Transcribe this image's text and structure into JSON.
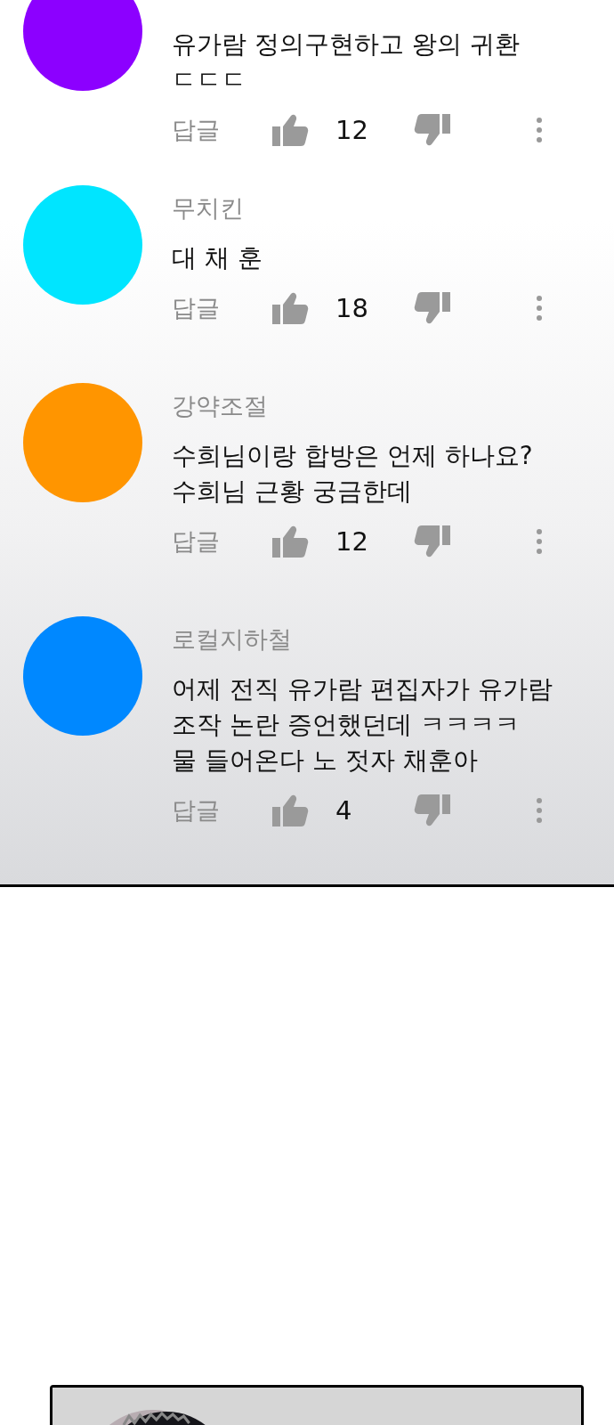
{
  "comments": [
    {
      "color": "#8c00ff",
      "body": [
        "유가람 정의구현하고 왕의 귀환",
        "ㄷㄷㄷ"
      ],
      "reply": "답글",
      "likes": "12"
    },
    {
      "color": "#00e5ff",
      "name": "무치킨",
      "body": [
        "대 채 훈"
      ],
      "reply": "답글",
      "likes": "18"
    },
    {
      "color": "#ff9500",
      "name": "강약조절",
      "body": [
        "수희님이랑 합방은 언제 하나요?",
        "수희님 근황 궁금한데"
      ],
      "reply": "답글",
      "likes": "12"
    },
    {
      "color": "#0088ff",
      "name": "로컬지하철",
      "body": [
        "어제 전직 유가람 편집자가 유가람",
        "조작 논란 증언했던데 ㅋㅋㅋㅋ",
        "물 들어온다 노 젓자 채훈아"
      ],
      "reply": "답글",
      "likes": "4"
    }
  ]
}
